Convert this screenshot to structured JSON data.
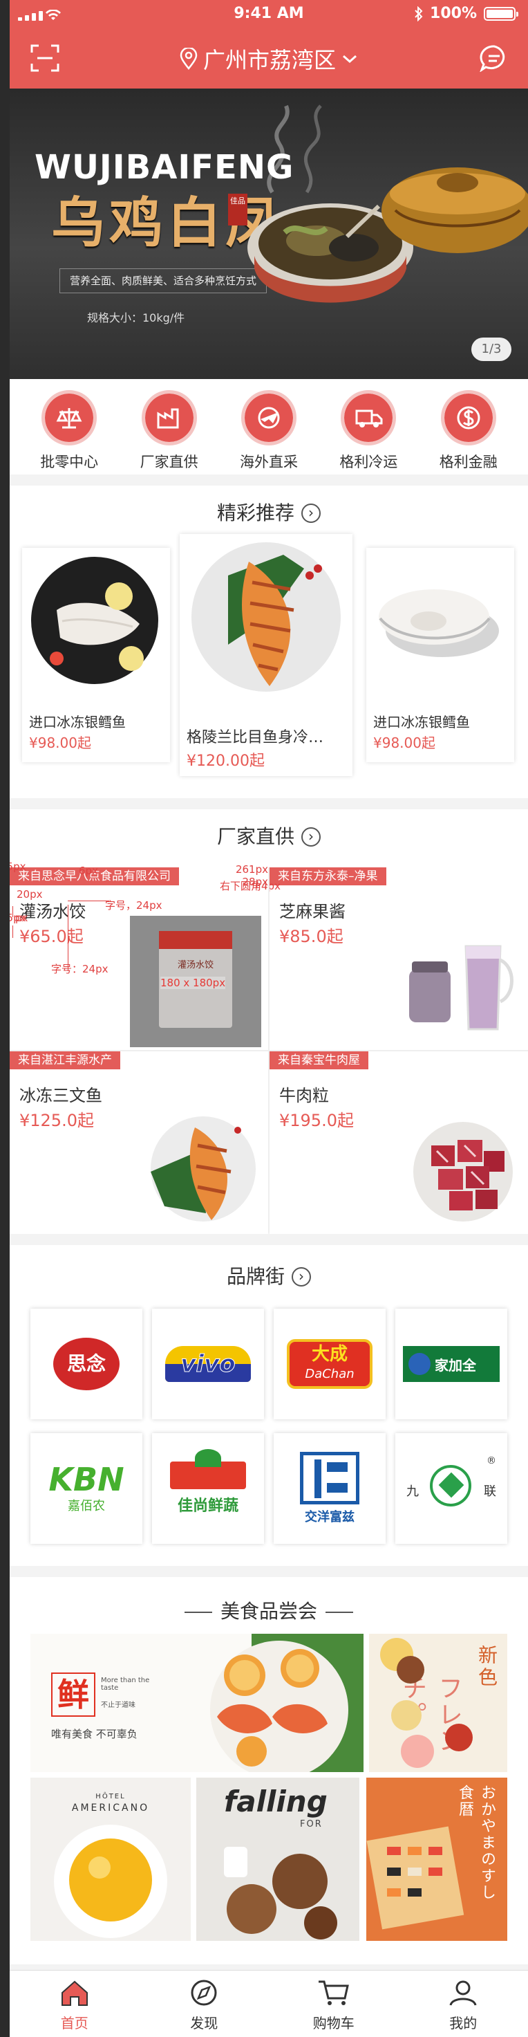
{
  "status_bar": {
    "time": "9:41 AM",
    "battery": "100%"
  },
  "header": {
    "location": "广州市荔湾区",
    "scan_icon": "scan-icon",
    "message_icon": "message-icon",
    "accent": "#e65a55"
  },
  "banner": {
    "brand_en": "WUJIBAIFENG",
    "brand_cn": "乌鸡白凤",
    "seal": "佳品",
    "tagline": "营养全面、肉质鲜美、适合多种烹饪方式",
    "specs": "规格大小：10kg/件",
    "pager": "1/3"
  },
  "categories": [
    {
      "label": "批零中心",
      "icon": "scale-icon"
    },
    {
      "label": "厂家直供",
      "icon": "factory-icon"
    },
    {
      "label": "海外直采",
      "icon": "plane-icon"
    },
    {
      "label": "格利冷运",
      "icon": "truck-icon"
    },
    {
      "label": "格利金融",
      "icon": "currency-icon"
    }
  ],
  "recommend": {
    "title": "精彩推荐",
    "items": [
      {
        "name": "进口冰冻银鳕鱼",
        "price": "¥98.00起"
      },
      {
        "name": "格陵兰比目鱼身冷…",
        "price": "¥120.00起"
      },
      {
        "name": "进口冰冻银鳕鱼",
        "price": "¥98.00起"
      }
    ]
  },
  "factory": {
    "title": "厂家直供",
    "items": [
      {
        "tag": "来自思念早八点食品有限公司",
        "name": "灌汤水饺",
        "price": "¥65.0起"
      },
      {
        "tag": "来自东方永泰–净果",
        "name": "芝麻果酱",
        "price": "¥85.0起"
      },
      {
        "tag": "来自湛江丰源水产",
        "name": "冰冻三文鱼",
        "price": "¥125.0起"
      },
      {
        "tag": "来自秦宝牛肉屋",
        "name": "牛肉粒",
        "price": "¥195.0起"
      }
    ],
    "annotations": {
      "a1": "15px",
      "a2": "6px",
      "a3": "261px 28px",
      "a4": "右下圆角4px",
      "a5": "20px",
      "a6": "字号，24px",
      "a7": "15px",
      "a8": "px",
      "a9": "字号：24px",
      "a10": "180 x 180px",
      "pkg": "灌汤水饺"
    }
  },
  "brands": {
    "title": "品牌街",
    "items": [
      {
        "name": "思念"
      },
      {
        "name": "vivo"
      },
      {
        "name": "大成",
        "sub": "DaChan"
      },
      {
        "name": "家加全"
      },
      {
        "name": "KBN",
        "sub": "嘉佰农"
      },
      {
        "name": "佳尚鲜蔬"
      },
      {
        "name": "交洋富兹"
      },
      {
        "name": "九联"
      }
    ]
  },
  "food": {
    "title": "美食品尝会",
    "tile1": {
      "big": "鲜",
      "en": "More than the taste",
      "en2": "不止于道味",
      "slogan": "唯有美食  不可辜负"
    },
    "tile2": {
      "text": "新色",
      "jp": "フレンチ。"
    },
    "tile3": {
      "hotel": "HÔTEL",
      "name": "AMERICANO"
    },
    "tile4": {
      "word": "falling",
      "sub": "FOR"
    },
    "tile5": {
      "text": "おかやまのすし食暦"
    }
  },
  "tabs": [
    {
      "label": "首页",
      "icon": "home-icon"
    },
    {
      "label": "发现",
      "icon": "compass-icon"
    },
    {
      "label": "购物车",
      "icon": "cart-icon"
    },
    {
      "label": "我的",
      "icon": "user-icon"
    }
  ]
}
